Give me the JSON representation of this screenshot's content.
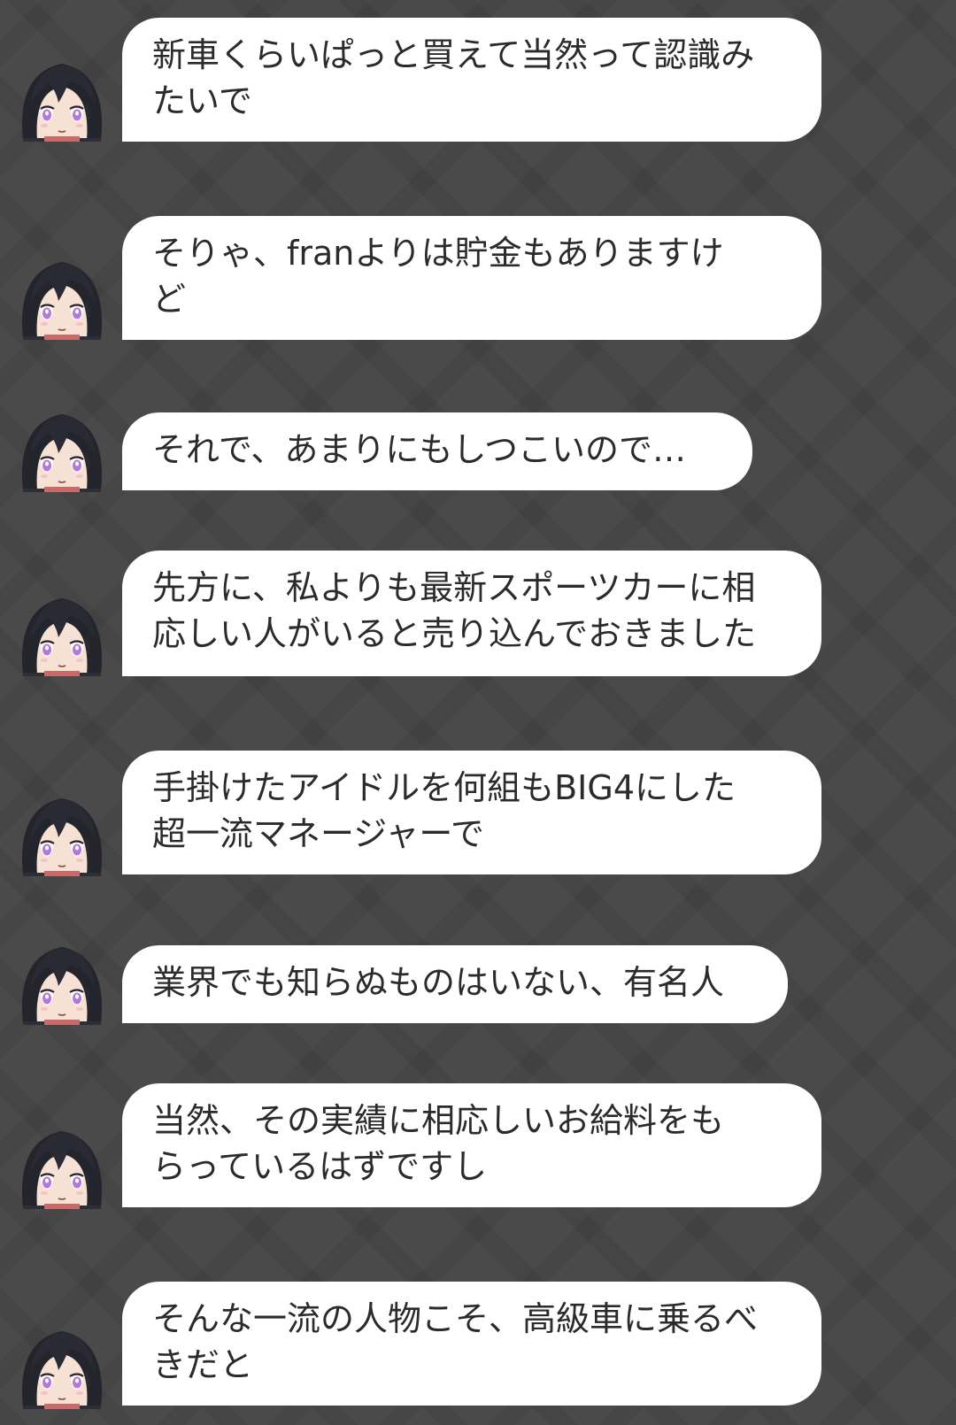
{
  "speaker_avatar": "black-haired-girl-avatar",
  "colors": {
    "background": "#4a4a4a",
    "bubble": "#ffffff",
    "text": "#2b2b2b"
  },
  "messages": [
    {
      "text": "新車くらいぱっと買えて当然って認識み\nたいで"
    },
    {
      "text": "そりゃ、franよりは貯金もありますけ\nど"
    },
    {
      "text": "それで、あまりにもしつこいので…"
    },
    {
      "text": "先方に、私よりも最新スポーツカーに相\n応しい人がいると売り込んでおきました"
    },
    {
      "text": "手掛けたアイドルを何組もBIG4にした\n超一流マネージャーで"
    },
    {
      "text": "業界でも知らぬものはいない、有名人"
    },
    {
      "text": "当然、その実績に相応しいお給料をも\nらっているはずですし"
    },
    {
      "text": "そんな一流の人物こそ、高級車に乗るべ\nきだと"
    }
  ]
}
